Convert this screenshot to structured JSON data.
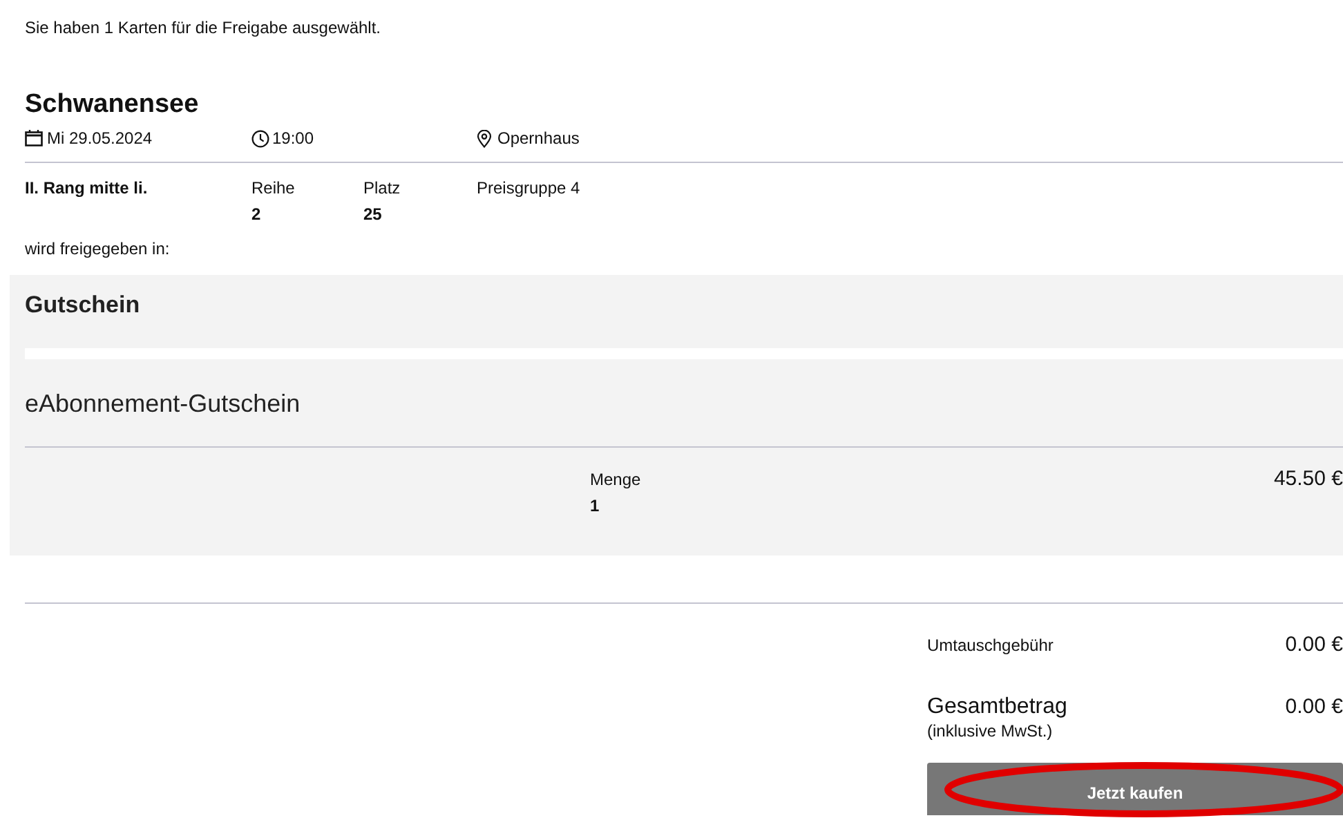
{
  "intro": "Sie haben 1 Karten für die Freigabe ausgewählt.",
  "event": {
    "title": "Schwanensee",
    "date": "Mi 29.05.2024",
    "time": "19:00",
    "venue": "Opernhaus"
  },
  "seat": {
    "area": "II. Rang mitte li.",
    "row_label": "Reihe",
    "row": "2",
    "seat_label": "Platz",
    "seat": "25",
    "price_group": "Preisgruppe 4"
  },
  "release_label": "wird freigegeben in:",
  "voucher": {
    "heading": "Gutschein",
    "product": "eAbonnement-Gutschein",
    "quantity_label": "Menge",
    "quantity": "1",
    "price": "45.50 €"
  },
  "summary": {
    "fee_label": "Umtauschgebühr",
    "fee": "0.00 €",
    "total_label": "Gesamtbetrag",
    "total": "0.00 €",
    "tax_note": "(inklusive MwSt.)"
  },
  "buy_button": "Jetzt kaufen"
}
